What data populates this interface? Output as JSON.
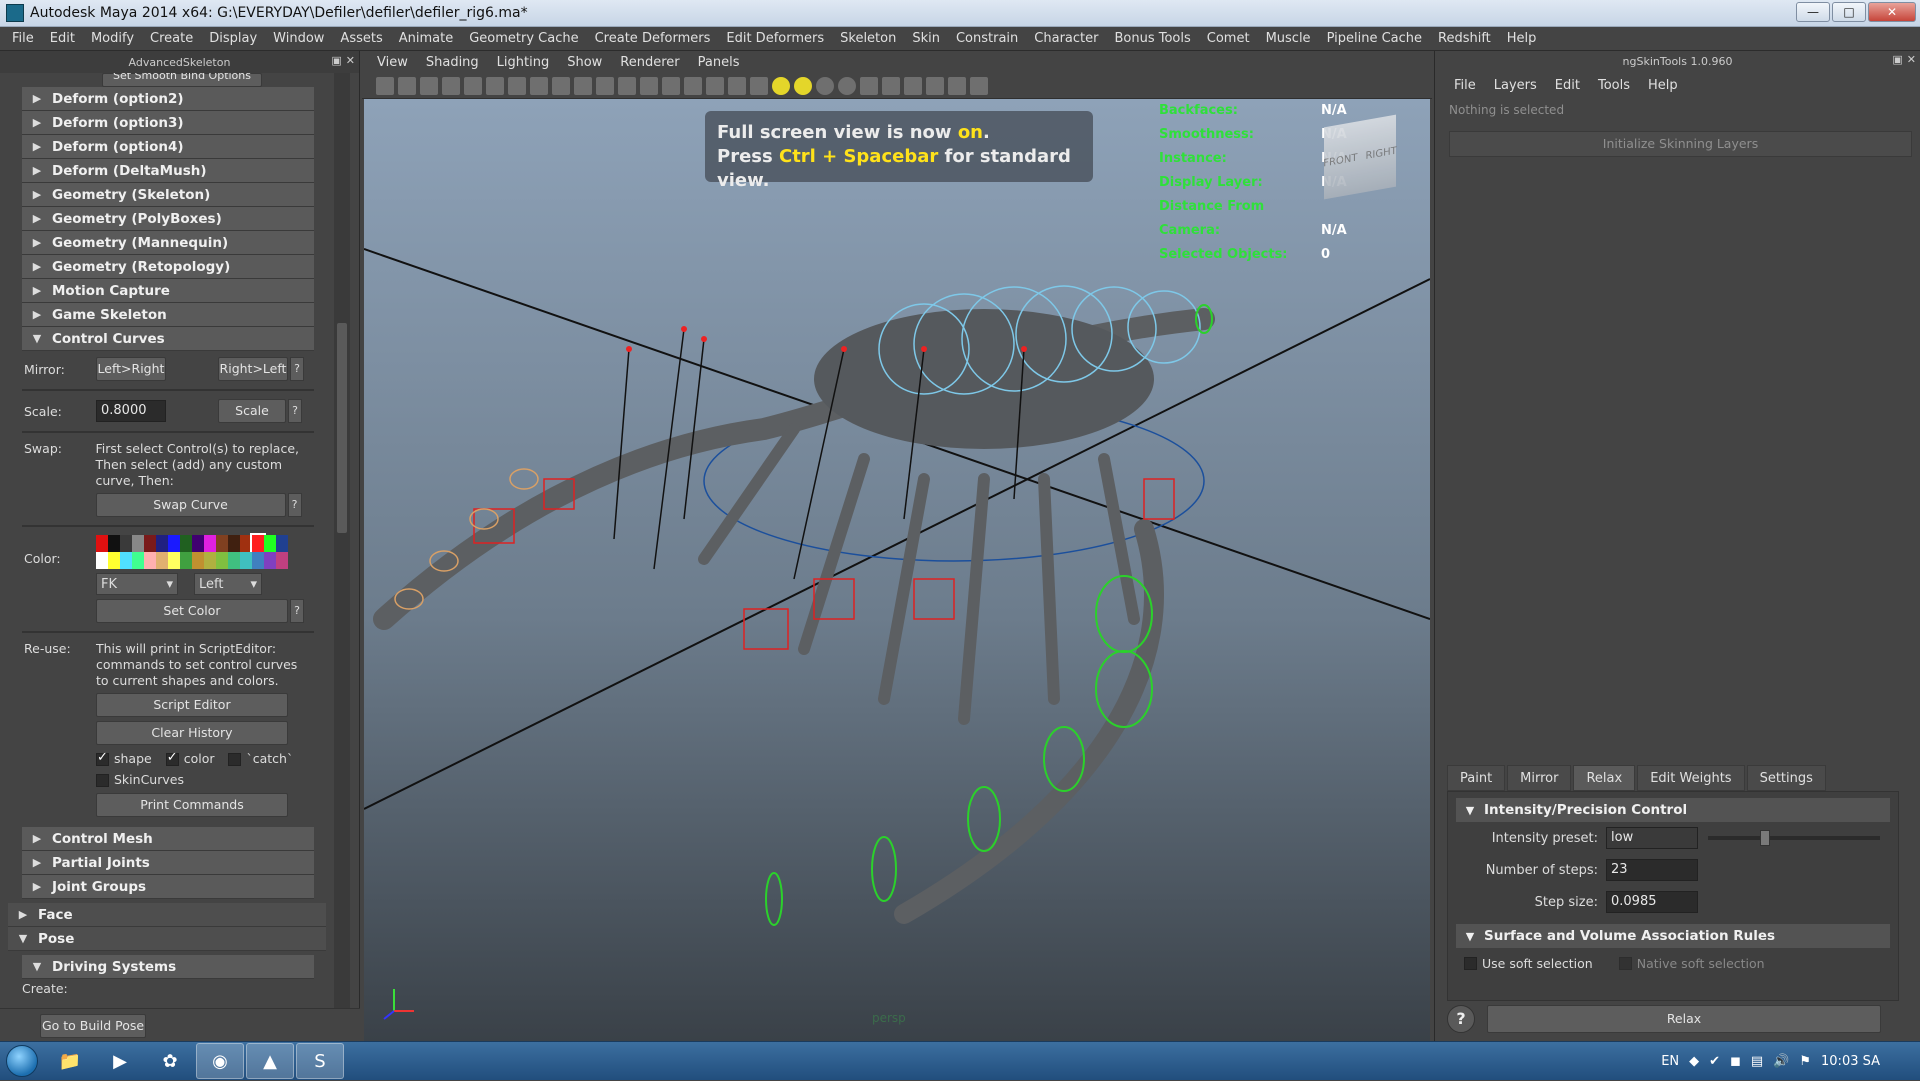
{
  "window": {
    "title": "Autodesk Maya 2014 x64: G:\\EVERYDAY\\Defiler\\defiler\\defiler_rig6.ma*",
    "minimize": "—",
    "maximize": "□",
    "close": "✕"
  },
  "menubar": [
    "File",
    "Edit",
    "Modify",
    "Create",
    "Display",
    "Window",
    "Assets",
    "Animate",
    "Geometry Cache",
    "Create Deformers",
    "Edit Deformers",
    "Skeleton",
    "Skin",
    "Constrain",
    "Character",
    "Bonus Tools",
    "Comet",
    "Muscle",
    "Pipeline Cache",
    "Redshift",
    "Help"
  ],
  "left_panel": {
    "title": "AdvancedSkeleton",
    "top_partial_button": "Set Smooth Bind Options",
    "frames_top": [
      {
        "label": "Deform     (option2)"
      },
      {
        "label": "Deform     (option3)"
      },
      {
        "label": "Deform     (option4)"
      },
      {
        "label": "Deform     (DeltaMush)"
      },
      {
        "label": "Geometry (Skeleton)"
      },
      {
        "label": "Geometry (PolyBoxes)"
      },
      {
        "label": "Geometry (Mannequin)"
      },
      {
        "label": "Geometry (Retopology)"
      },
      {
        "label": "Motion Capture"
      },
      {
        "label": "Game Skeleton"
      }
    ],
    "control_curves": {
      "label": "Control Curves",
      "mirror_label": "Mirror:",
      "mirror_lr": "Left>Right",
      "mirror_rl": "Right>Left",
      "scale_label": "Scale:",
      "scale_value": "0.8000",
      "scale_button": "Scale",
      "swap_label": "Swap:",
      "swap_text": "First select Control(s) to replace, Then select (add) any custom curve, Then:",
      "swap_button": "Swap Curve",
      "color_label": "Color:",
      "color_swatches": [
        "#e01010",
        "#111111",
        "#3a3a3a",
        "#888888",
        "#7a1a1a",
        "#202080",
        "#1a1aff",
        "#206020",
        "#400070",
        "#e020e0",
        "#804020",
        "#402010",
        "#a03010",
        "#ff2020",
        "#20ff20",
        "#204090",
        "#ffffff",
        "#ffff30",
        "#50e0ff",
        "#40ff90",
        "#ffb0b0",
        "#e0b070",
        "#ffff60",
        "#40a040",
        "#c09030",
        "#b0b040",
        "#80c040",
        "#40c080",
        "#40c0c0",
        "#4080c0",
        "#8040c0",
        "#c04080"
      ],
      "type_select": "FK",
      "side_select": "Left",
      "set_color_button": "Set Color",
      "reuse_label": "Re-use:",
      "reuse_text": "This will print in ScriptEditor: commands to set control curves to current shapes and colors.",
      "script_editor_button": "Script Editor",
      "clear_history_button": "Clear History",
      "chk_shape": "shape",
      "chk_color": "color",
      "chk_catch": "`catch`",
      "chk_skincurves": "SkinCurves",
      "print_commands_button": "Print Commands",
      "question": "?"
    },
    "frames_bottom": [
      {
        "label": "Control Mesh"
      },
      {
        "label": "Partial Joints"
      },
      {
        "label": "Joint Groups"
      }
    ],
    "frames_outer": [
      {
        "label": "Face"
      },
      {
        "label": "Pose"
      }
    ],
    "driving_systems": "Driving Systems",
    "create_label": "Create:",
    "go_build_pose": "Go to Build Pose"
  },
  "viewport": {
    "menu": [
      "View",
      "Shading",
      "Lighting",
      "Show",
      "Renderer",
      "Panels"
    ],
    "notice_line1_a": "Full screen view is now ",
    "notice_line1_b": "on",
    "notice_line1_c": ".",
    "notice_line2_a": "Press ",
    "notice_line2_b": "Ctrl + Spacebar",
    "notice_line2_c": " for standard view.",
    "hud": [
      {
        "k": "Backfaces:",
        "v": "N/A"
      },
      {
        "k": "Smoothness:",
        "v": "N/A"
      },
      {
        "k": "Instance:",
        "v": "N/A"
      },
      {
        "k": "Display Layer:",
        "v": "N/A"
      },
      {
        "k": "Distance From Camera:",
        "v": "N/A"
      },
      {
        "k": "Selected Objects:",
        "v": "0"
      }
    ],
    "viewcube_front": "FRONT",
    "viewcube_right": "RIGHT",
    "camera": "persp"
  },
  "right_panel": {
    "title": "ngSkinTools 1.0.960",
    "menu": [
      "File",
      "Layers",
      "Edit",
      "Tools",
      "Help"
    ],
    "status": "Nothing is selected",
    "init_button": "Initialize Skinning Layers",
    "tabs": [
      "Paint",
      "Mirror",
      "Relax",
      "Edit Weights",
      "Settings"
    ],
    "active_tab": "Relax",
    "section1": "Intensity/Precision Control",
    "intensity_label": "Intensity preset:",
    "intensity_value": "low",
    "steps_label": "Number of steps:",
    "steps_value": "23",
    "stepsize_label": "Step size:",
    "stepsize_value": "0.0985",
    "section2": "Surface and Volume Association Rules",
    "soft_label": "Use soft selection",
    "native_soft_label": "Native soft selection",
    "relax_button": "Relax",
    "help": "?"
  },
  "taskbar": {
    "lang": "EN",
    "time": "10:03 SA"
  }
}
